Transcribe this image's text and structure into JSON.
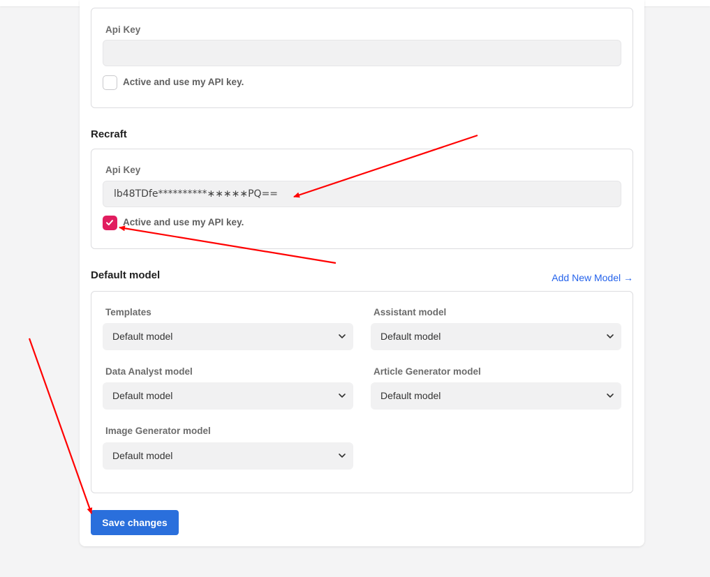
{
  "section1": {
    "api_key_label": "Api Key",
    "api_key_value": "",
    "checkbox_label": "Active and use my API key.",
    "checked": false
  },
  "recraft": {
    "title": "Recraft",
    "api_key_label": "Api Key",
    "api_key_value": "lb48TDfe**********∗∗∗∗∗PQ==",
    "checkbox_label": "Active and use my API key.",
    "checked": true
  },
  "default_model": {
    "title": "Default model",
    "add_link": "Add New Model →",
    "fields": [
      {
        "label": "Templates",
        "value": "Default model"
      },
      {
        "label": "Assistant model",
        "value": "Default model"
      },
      {
        "label": "Data Analyst model",
        "value": "Default model"
      },
      {
        "label": "Article Generator model",
        "value": "Default model"
      },
      {
        "label": "Image Generator model",
        "value": "Default model"
      }
    ]
  },
  "save_button": "Save changes",
  "colors": {
    "accent_blue": "#2a6fdc",
    "link_blue": "#2563eb",
    "checkbox_pink": "#e11d5f",
    "annotation_red": "#ff0000"
  },
  "icons": {
    "checkmark": "check-icon",
    "select_chevron": "chevron-down-icon",
    "annotation": "red-arrow-annotation"
  }
}
